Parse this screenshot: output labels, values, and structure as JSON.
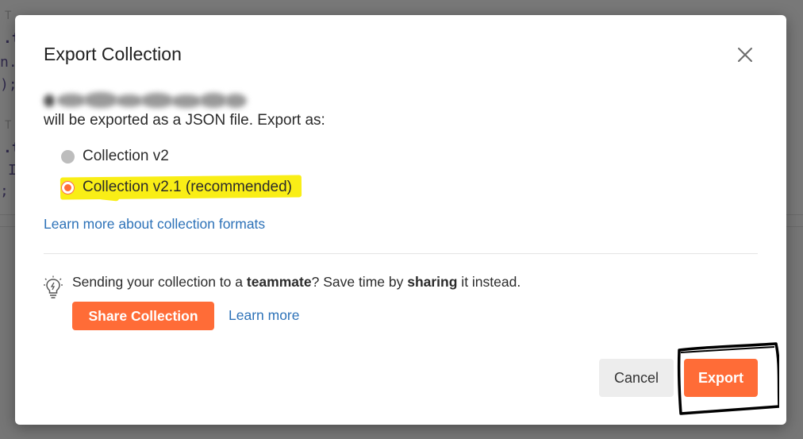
{
  "dialog": {
    "title": "Export Collection",
    "description": "will be exported as a JSON file. Export as:",
    "options": [
      {
        "label": "Collection v2",
        "selected": false
      },
      {
        "label": "Collection v2.1 (recommended)",
        "selected": true
      }
    ],
    "learn_formats_link": "Learn more about collection formats",
    "share": {
      "text_1": "Sending your collection to a ",
      "bold_1": "teammate",
      "text_2": "? Save time by ",
      "bold_2": "sharing",
      "text_3": " it instead.",
      "button_label": "Share Collection",
      "learn_more_link": "Learn more"
    },
    "cancel_label": "Cancel",
    "export_label": "Export"
  },
  "colors": {
    "accent": "#ff6c37",
    "link": "#2d72b8",
    "highlight": "#f9ee16"
  },
  "icons": {
    "close": "close-icon",
    "lightbulb": "lightbulb-icon"
  }
}
